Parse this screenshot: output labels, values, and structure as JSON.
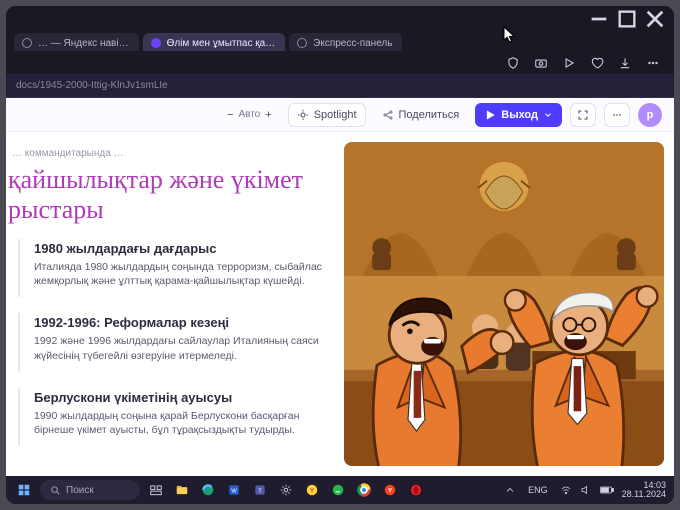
{
  "window": {
    "tabs": [
      {
        "label": "… — Яндекс наві…",
        "active": false
      },
      {
        "label": "Өлім мен ұмытпас қа…",
        "active": true
      },
      {
        "label": "Экспресс-панель",
        "active": false
      }
    ]
  },
  "app": {
    "url": "docs/1945-2000-Ittig-KlnJv1smLIe"
  },
  "toolbar": {
    "zoom_minus": "−",
    "zoom_label": "Авто",
    "zoom_plus": "+",
    "spotlight": "Spotlight",
    "share": "Поделиться",
    "exit": "Выход",
    "avatar_initial": "p"
  },
  "doc": {
    "breadcrumb": "… коммандитарында …",
    "title_line1": "қайшылықтар және үкімет",
    "title_line2": "рыстары",
    "sections": [
      {
        "heading": "1980 жылдардағы дағдарыс",
        "body": "Италияда 1980 жылдардың соңында терроризм, сыбайлас жемқорлық және ұлттық қарама-қайшылықтар күшейді."
      },
      {
        "heading": "1992-1996: Реформалар кезеңі",
        "body": "1992 және 1996 жылдардағы сайлаулар Италияның саяси жүйесінің түбегейлі өзгеруіне итермеледі."
      },
      {
        "heading": "Берлускони үкіметінің ауысуы",
        "body": "1990 жылдардың соңына қарай Берлускони басқарған бірнеше үкімет ауысты, бұл тұрақсыздықты тудырды."
      }
    ]
  },
  "taskbar": {
    "search_placeholder": "Поиск",
    "lang": "ENG",
    "time": "14:03",
    "date": "28.11.2024"
  },
  "colors": {
    "accent": "#4f3cff",
    "title": "#b03ab8"
  },
  "icons": {
    "start": "windows-icon",
    "search": "search-icon",
    "share": "share-icon",
    "spotlight": "spotlight-icon",
    "download": "download-icon",
    "heart": "heart-icon",
    "play": "play-icon",
    "camera": "camera-icon",
    "shield": "shield-icon",
    "expand": "expand-icon",
    "chevron": "chevron-down-icon",
    "close": "close-icon",
    "min": "minimize-icon",
    "max": "maximize-icon"
  }
}
